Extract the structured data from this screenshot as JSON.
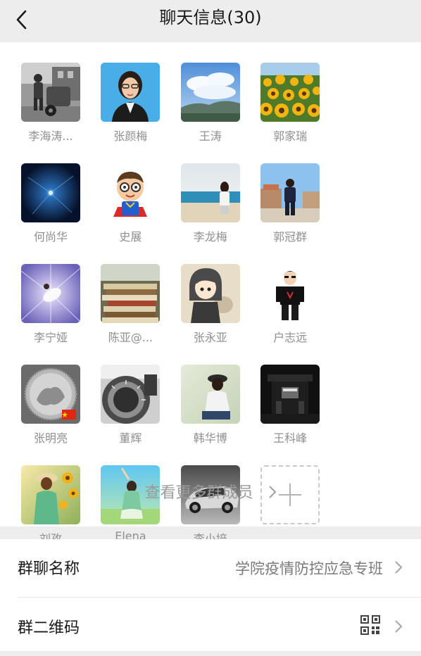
{
  "header": {
    "title": "聊天信息(30)"
  },
  "members": [
    {
      "name": "李海涛...",
      "avatar": "photo-street-worker"
    },
    {
      "name": "张颜梅",
      "avatar": "photo-woman-portrait"
    },
    {
      "name": "王涛",
      "avatar": "photo-sky-mountains"
    },
    {
      "name": "郭家瑞",
      "avatar": "photo-sunflowers"
    },
    {
      "name": "何尚华",
      "avatar": "photo-night-light"
    },
    {
      "name": "史展",
      "avatar": "cartoon-boy-glasses"
    },
    {
      "name": "李龙梅",
      "avatar": "photo-seaside-girl"
    },
    {
      "name": "郭冠群",
      "avatar": "photo-man-square"
    },
    {
      "name": "李宁娅",
      "avatar": "photo-dancer"
    },
    {
      "name": "陈亚@...",
      "avatar": "photo-books-stack"
    },
    {
      "name": "张永亚",
      "avatar": "cartoon-hooded-boy"
    },
    {
      "name": "户志远",
      "avatar": "cartoon-man-black"
    },
    {
      "name": "张明亮",
      "avatar": "photo-coin"
    },
    {
      "name": "董辉",
      "avatar": "photo-camera-dial"
    },
    {
      "name": "韩华博",
      "avatar": "photo-girl-hat"
    },
    {
      "name": "王科峰",
      "avatar": "photo-dark-building"
    },
    {
      "name": "刘孜",
      "avatar": "photo-girl-sunflowers"
    },
    {
      "name": "Elena",
      "avatar": "photo-girl-green"
    },
    {
      "name": "李小培",
      "avatar": "photo-sports-car"
    }
  ],
  "add_member": {
    "icon": "plus-icon"
  },
  "more_members": {
    "label": "查看更多群成员"
  },
  "group_name": {
    "label": "群聊名称",
    "value": "学院疫情防控应急专班"
  },
  "qr_code": {
    "label": "群二维码",
    "icon": "qr-code-icon"
  }
}
